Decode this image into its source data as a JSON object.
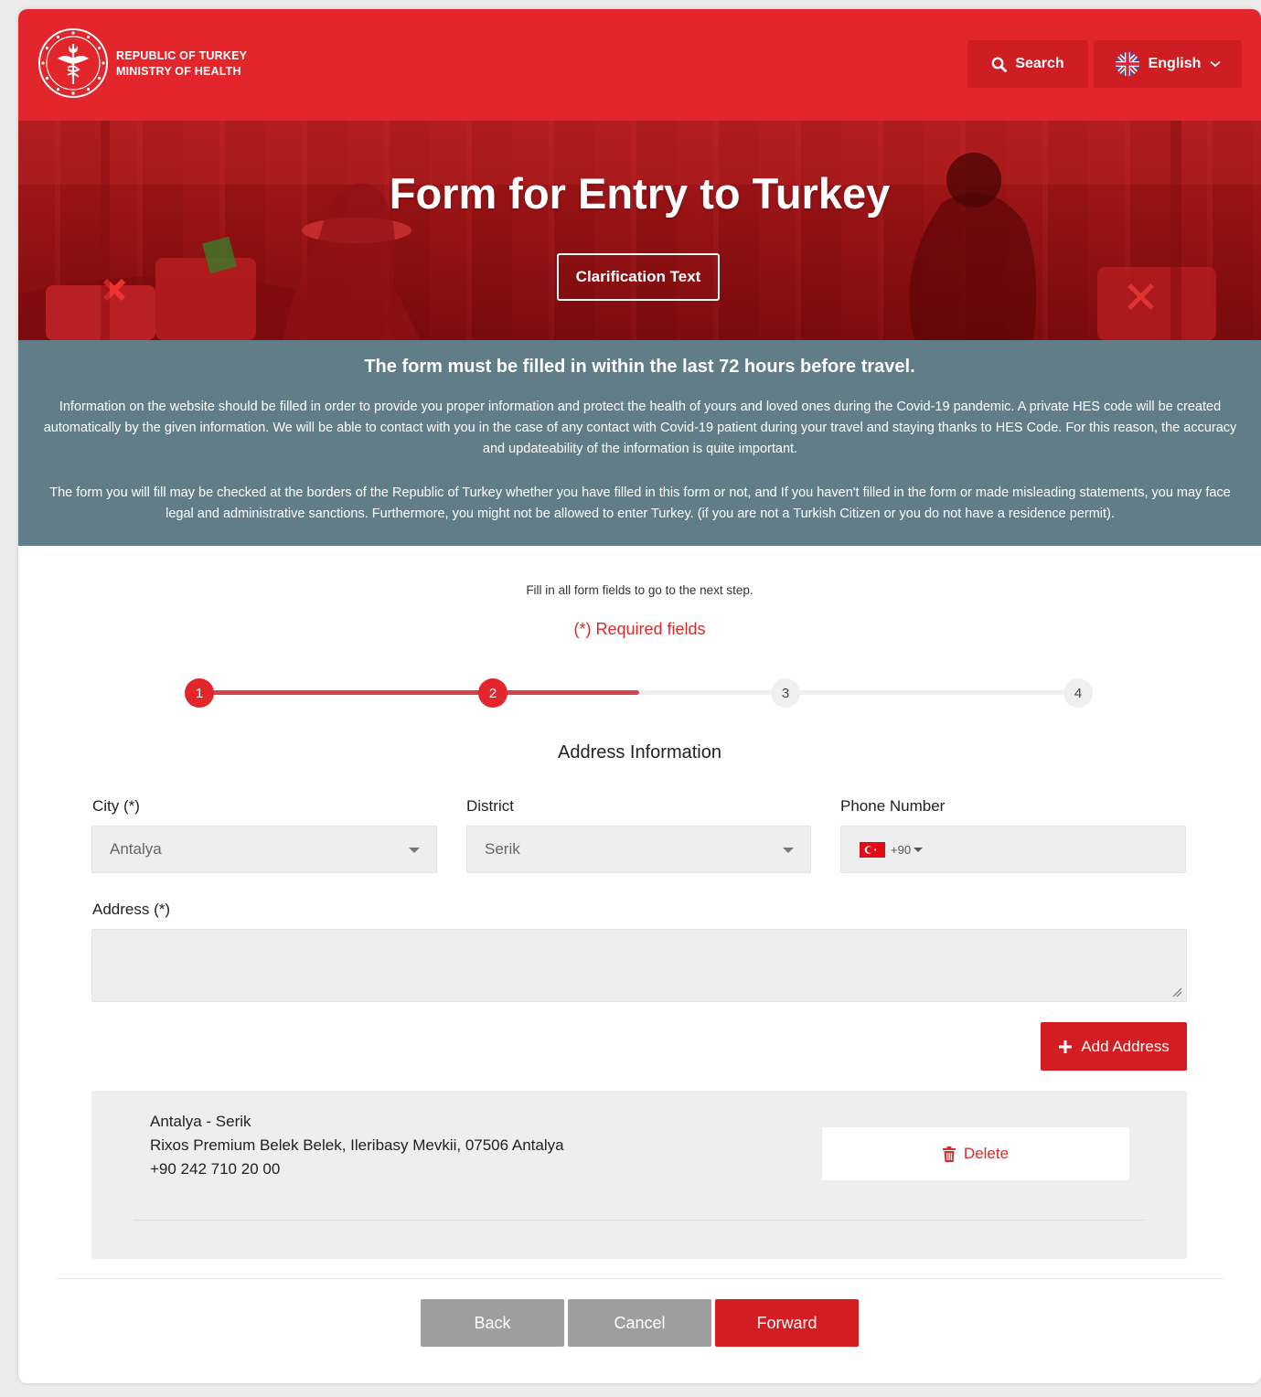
{
  "header": {
    "logo_line1": "REPUBLIC OF TURKEY",
    "logo_line2": "MINISTRY OF HEALTH",
    "search_label": "Search",
    "language_label": "English"
  },
  "hero": {
    "title": "Form for Entry to Turkey",
    "clarification_label": "Clarification Text"
  },
  "info": {
    "heading": "The form must be filled in within the last 72 hours before travel.",
    "paragraph1": "Information on the website should be filled in order to provide you proper information and protect the health of yours and loved ones during the Covid-19 pandemic. A private HES code will be created automatically by the given information. We will be able to contact with you in the case of any contact with Covid-19 patient during your travel and staying thanks to HES Code. For this reason, the accuracy and updateability of the information is quite important.",
    "paragraph2": "The form you will fill may be checked at the borders of the Republic of Turkey whether you have filled in this form or not, and If you haven't filled in the form or made misleading statements, you may face legal and administrative sanctions. Furthermore, you might not be allowed to enter Turkey. (if you are not a Turkish Citizen or you do not have a residence permit)."
  },
  "form": {
    "instruction": "Fill in all form fields to go to the next step.",
    "required_note": "(*) Required fields",
    "steps": [
      "1",
      "2",
      "3",
      "4"
    ],
    "current_step": 2,
    "progress": 0.5,
    "section_title": "Address Information",
    "city_label": "City (*)",
    "city_value": "Antalya",
    "district_label": "District",
    "district_value": "Serik",
    "phone_label": "Phone Number",
    "phone_code": "+90",
    "address_label": "Address (*)",
    "address_value": "",
    "add_address_label": "Add Address"
  },
  "saved_address": {
    "city_district": "Antalya - Serik",
    "street": "Rixos Premium Belek Belek, Ileribasy Mevkii, 07506 Antalya",
    "phone": "+90 242 710 20 00",
    "delete_label": "Delete"
  },
  "nav": {
    "back_label": "Back",
    "cancel_label": "Cancel",
    "forward_label": "Forward"
  },
  "colors": {
    "brand_red": "#e3262b",
    "button_red": "#d41d22",
    "info_band": "#607d88",
    "disabled_gray": "#9e9e9e"
  }
}
